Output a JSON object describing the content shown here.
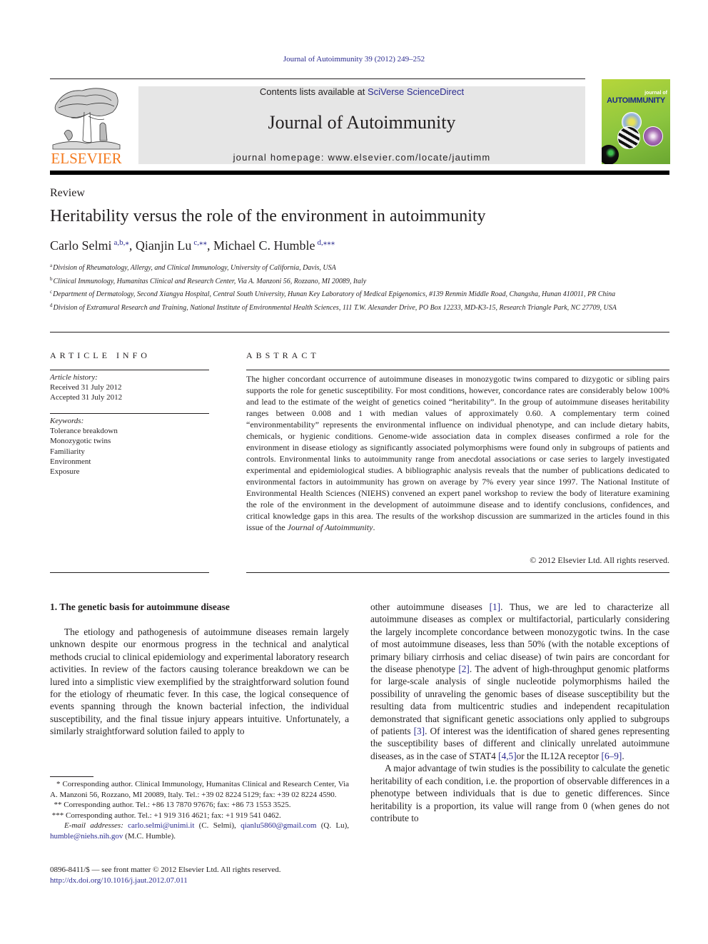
{
  "header": {
    "journal_ref": "Journal of Autoimmunity 39 (2012) 249–252",
    "contents_prefix": "Contents lists available at ",
    "contents_link": "SciVerse ScienceDirect",
    "journal_name": "Journal of Autoimmunity",
    "homepage": "journal homepage: www.elsevier.com/locate/jautimm",
    "publisher_logo_text": "ELSEVIER",
    "cover_small": "journal of",
    "cover_big": "AUTOIMMUNITY"
  },
  "colors": {
    "link": "#2b2b8f",
    "elsevier_orange": "#f47b20",
    "banner_gray": "#e6e6e6",
    "cover_green": "#8dc63f"
  },
  "article": {
    "section_type": "Review",
    "title": "Heritability versus the role of the environment in autoimmunity",
    "authors": [
      {
        "name": "Carlo Selmi",
        "sup": "a,b,⁎",
        "sep": ", "
      },
      {
        "name": "Qianjin Lu",
        "sup": "c,⁎⁎",
        "sep": ", "
      },
      {
        "name": "Michael C. Humble",
        "sup": "d,⁎⁎⁎",
        "sep": ""
      }
    ],
    "affiliations": [
      {
        "mark": "a",
        "text": "Division of Rheumatology, Allergy, and Clinical Immunology, University of California, Davis, USA"
      },
      {
        "mark": "b",
        "text": "Clinical Immunology, Humanitas Clinical and Research Center, Via A. Manzoni 56, Rozzano, MI 20089, Italy"
      },
      {
        "mark": "c",
        "text": "Department of Dermatology, Second Xiangya Hospital, Central South University, Hunan Key Laboratory of Medical Epigenomics, #139 Renmin Middle Road, Changsha, Hunan 410011, PR China"
      },
      {
        "mark": "d",
        "text": "Division of Extramural Research and Training, National Institute of Environmental Health Sciences, 111 T.W. Alexander Drive, PO Box 12233, MD-K3-15, Research Triangle Park, NC 27709, USA"
      }
    ]
  },
  "article_info": {
    "heading": "ARTICLE INFO",
    "history_label": "Article history:",
    "received": "Received 31 July 2012",
    "accepted": "Accepted 31 July 2012",
    "keywords_label": "Keywords:",
    "keywords": [
      "Tolerance breakdown",
      "Monozygotic twins",
      "Familiarity",
      "Environment",
      "Exposure"
    ]
  },
  "abstract": {
    "heading": "ABSTRACT",
    "text": "The higher concordant occurrence of autoimmune diseases in monozygotic twins compared to dizygotic or sibling pairs supports the role for genetic susceptibility. For most conditions, however, concordance rates are considerably below 100% and lead to the estimate of the weight of genetics coined “heritability”. In the group of autoimmune diseases heritability ranges between 0.008 and 1 with median values of approximately 0.60. A complementary term coined “environmentability” represents the environmental influence on individual phenotype, and can include dietary habits, chemicals, or hygienic conditions. Genome-wide association data in complex diseases confirmed a role for the environment in disease etiology as significantly associated polymorphisms were found only in subgroups of patients and controls. Environmental links to autoimmunity range from anecdotal associations or case series to largely investigated experimental and epidemiological studies. A bibliographic analysis reveals that the number of publications dedicated to environmental factors in autoimmunity has grown on average by 7% every year since 1997. The National Institute of Environmental Health Sciences (NIEHS) convened an expert panel workshop to review the body of literature examining the role of the environment in the development of autoimmune disease and to identify conclusions, confidences, and critical knowledge gaps in this area. The results of the workshop discussion are summarized in the articles found in this issue of the ",
    "journal_italic": "Journal of Autoimmunity",
    "end": ".",
    "copyright": "© 2012 Elsevier Ltd. All rights reserved."
  },
  "body": {
    "section_heading": "1.  The genetic basis for autoimmune disease",
    "left_paragraph": "The etiology and pathogenesis of autoimmune diseases remain largely unknown despite our enormous progress in the technical and analytical methods crucial to clinical epidemiology and experimental laboratory research activities. In review of the factors causing tolerance breakdown we can be lured into a simplistic view exemplified by the straightforward solution found for the etiology of rheumatic fever. In this case, the logical consequence of events spanning through the known bacterial infection, the individual susceptibility, and the final tissue injury appears intuitive. Unfortunately, a similarly straightforward solution failed to apply to",
    "right_p1": [
      {
        "t": "other autoimmune diseases "
      },
      {
        "ref": "[1]"
      },
      {
        "t": ". Thus, we are led to characterize all autoimmune diseases as complex or multifactorial, particularly considering the largely incomplete concordance between monozygotic twins. In the case of most autoimmune diseases, less than 50% (with the notable exceptions of primary biliary cirrhosis and celiac disease) of twin pairs are concordant for the disease phenotype "
      },
      {
        "ref": "[2]"
      },
      {
        "t": ". The advent of high-throughput genomic platforms for large-scale analysis of single nucleotide polymorphisms hailed the possibility of unraveling the genomic bases of disease susceptibility but the resulting data from multicentric studies and independent recapitulation demonstrated that significant genetic associations only applied to subgroups of patients "
      },
      {
        "ref": "[3]"
      },
      {
        "t": ". Of interest was the identification of shared genes representing the susceptibility bases of different and clinically unrelated autoimmune diseases, as in the case of STAT4 "
      },
      {
        "ref": "[4,5]"
      },
      {
        "t": "or the IL12A receptor "
      },
      {
        "ref": "[6–9]"
      },
      {
        "t": "."
      }
    ],
    "right_p2": "A major advantage of twin studies is the possibility to calculate the genetic heritability of each condition, i.e. the proportion of observable differences in a phenotype between individuals that is due to genetic differences. Since heritability is a proportion, its value will range from 0 (when genes do not contribute to"
  },
  "footnotes": {
    "fn1_mark": "*",
    "fn1": "Corresponding author. Clinical Immunology, Humanitas Clinical and Research Center, Via A. Manzoni 56, Rozzano, MI 20089, Italy. Tel.: +39 02 8224 5129; fax: +39 02 8224 4590.",
    "fn2_mark": "**",
    "fn2": "Corresponding author. Tel.: +86 13 7870 97676; fax: +86 73 1553 3525.",
    "fn3_mark": "***",
    "fn3": "Corresponding author. Tel.: +1 919 316 4621; fax: +1 919 541 0462.",
    "email_label": "E-mail addresses:",
    "emails": [
      {
        "address": "carlo.selmi@unimi.it",
        "who": "(C. Selmi),"
      },
      {
        "address": "qianlu5860@gmail.com",
        "who": "(Q. Lu),"
      },
      {
        "address": "humble@niehs.nih.gov",
        "who": "(M.C. Humble)."
      }
    ]
  },
  "issn": {
    "line": "0896-8411/$ — see front matter © 2012 Elsevier Ltd. All rights reserved.",
    "doi": "http://dx.doi.org/10.1016/j.jaut.2012.07.011"
  }
}
